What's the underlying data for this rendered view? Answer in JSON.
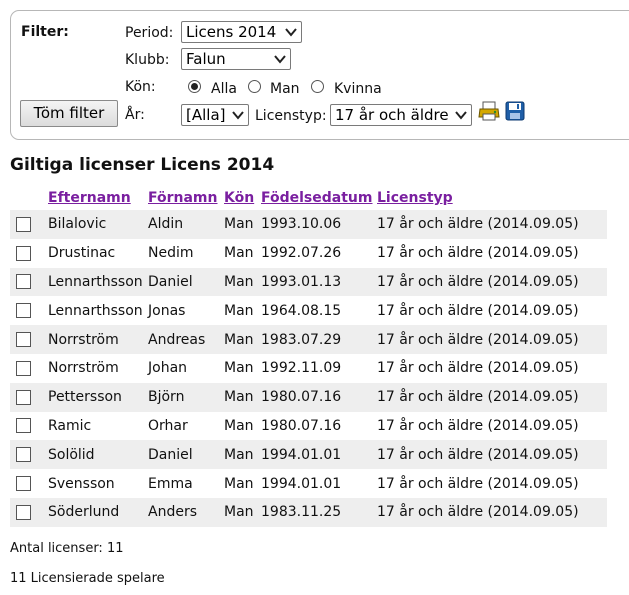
{
  "filter": {
    "title": "Filter:",
    "period_label": "Period:",
    "period_value": "Licens 2014",
    "club_label": "Klubb:",
    "club_value": "Falun",
    "gender_label": "Kön:",
    "gender_options": [
      "Alla",
      "Man",
      "Kvinna"
    ],
    "gender_selected": "Alla",
    "year_label": "År:",
    "year_value": "[Alla]",
    "license_type_label": "Licenstyp:",
    "license_type_value": "17 år och äldre",
    "clear_button": "Töm filter",
    "icons": [
      "printer-icon",
      "save-icon"
    ]
  },
  "heading": "Giltiga licenser Licens 2014",
  "table": {
    "columns": [
      "Efternamn",
      "Förnamn",
      "Kön",
      "Födelsedatum",
      "Licenstyp"
    ],
    "rows": [
      [
        "Bilalovic",
        "Aldin",
        "Man",
        "1993.10.06",
        "17 år och äldre (2014.09.05)"
      ],
      [
        "Drustinac",
        "Nedim",
        "Man",
        "1992.07.26",
        "17 år och äldre (2014.09.05)"
      ],
      [
        "Lennarthsson",
        "Daniel",
        "Man",
        "1993.01.13",
        "17 år och äldre (2014.09.05)"
      ],
      [
        "Lennarthsson",
        "Jonas",
        "Man",
        "1964.08.15",
        "17 år och äldre (2014.09.05)"
      ],
      [
        "Norrström",
        "Andreas",
        "Man",
        "1983.07.29",
        "17 år och äldre (2014.09.05)"
      ],
      [
        "Norrström",
        "Johan",
        "Man",
        "1992.11.09",
        "17 år och äldre (2014.09.05)"
      ],
      [
        "Pettersson",
        "Björn",
        "Man",
        "1980.07.16",
        "17 år och äldre (2014.09.05)"
      ],
      [
        "Ramic",
        "Orhar",
        "Man",
        "1980.07.16",
        "17 år och äldre (2014.09.05)"
      ],
      [
        "Solölid",
        "Daniel",
        "Man",
        "1994.01.01",
        "17 år och äldre (2014.09.05)"
      ],
      [
        "Svensson",
        "Emma",
        "Man",
        "1994.01.01",
        "17 år och äldre (2014.09.05)"
      ],
      [
        "Söderlund",
        "Anders",
        "Man",
        "1983.11.25",
        "17 år och äldre (2014.09.05)"
      ]
    ]
  },
  "footer": {
    "count_text": "Antal licenser: 11",
    "players_text": "11 Licensierade spelare"
  },
  "colors": {
    "header_link": "#7a1fa0",
    "row_shade": "#eeeeee",
    "save_icon": "#1f5fa8",
    "printer_icon": "#c9a000"
  }
}
